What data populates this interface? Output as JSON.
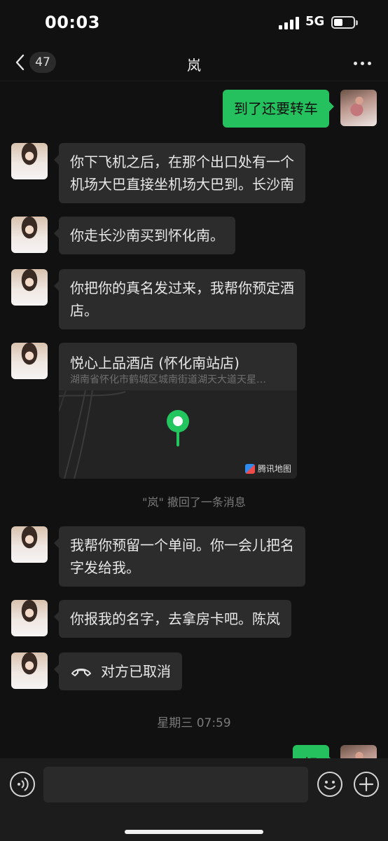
{
  "status_bar": {
    "time": "00:03",
    "network": "5G"
  },
  "header": {
    "unread_count": "47",
    "title": "岚"
  },
  "messages": [
    {
      "from": "me",
      "text": "到了还要转车"
    },
    {
      "from": "her",
      "lines": [
        "你下飞机之后，在那个出口处有一个",
        "机场大巴直接坐机场大巴到。长沙南"
      ]
    },
    {
      "from": "her",
      "text": "你走长沙南买到怀化南。"
    },
    {
      "from": "her",
      "lines": [
        "你把你的真名发过来，我帮你预定酒",
        "店。"
      ]
    },
    {
      "from": "her",
      "type": "location",
      "name": "悦心上品酒店 (怀化南站店)",
      "address": "湖南省怀化市鹤城区城南街道湖天大道天星…",
      "map_provider": "腾讯地图"
    },
    {
      "type": "system",
      "text": "\"岚\" 撤回了一条消息"
    },
    {
      "from": "her",
      "lines": [
        "我帮你预留一个单间。你一会儿把名",
        "字发给我。"
      ]
    },
    {
      "from": "her",
      "text": "你报我的名字，去拿房卡吧。陈岚"
    },
    {
      "from": "her",
      "type": "call",
      "text": "对方已取消"
    },
    {
      "type": "timestamp",
      "text": "星期三 07:59"
    },
    {
      "from": "me",
      "text": "好"
    }
  ],
  "colors": {
    "background": "#111111",
    "bubble_in": "#2c2c2c",
    "bubble_out": "#26c15f",
    "pin": "#22c55e"
  }
}
